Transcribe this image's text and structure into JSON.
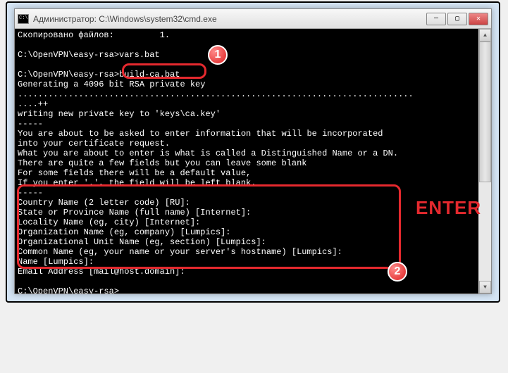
{
  "window": {
    "title": "Администратор: C:\\Windows\\system32\\cmd.exe"
  },
  "console": {
    "line1": "Скопировано файлов:         1.",
    "line2": "",
    "line3": "C:\\OpenVPN\\easy-rsa>vars.bat",
    "line4": "",
    "line5": "C:\\OpenVPN\\easy-rsa>build-ca.bat",
    "line6": "Generating a 4096 bit RSA private key",
    "line7": "..............................................................................",
    "line8": "....++",
    "line9": "writing new private key to 'keys\\ca.key'",
    "line10": "-----",
    "line11": "You are about to be asked to enter information that will be incorporated",
    "line12": "into your certificate request.",
    "line13": "What you are about to enter is what is called a Distinguished Name or a DN.",
    "line14": "There are quite a few fields but you can leave some blank",
    "line15": "For some fields there will be a default value,",
    "line16": "If you enter '.', the field will be left blank.",
    "line17": "-----",
    "line18": "Country Name (2 letter code) [RU]:",
    "line19": "State or Province Name (full name) [Internet]:",
    "line20": "Locality Name (eg, city) [Internet]:",
    "line21": "Organization Name (eg, company) [Lumpics]:",
    "line22": "Organizational Unit Name (eg, section) [Lumpics]:",
    "line23": "Common Name (eg, your name or your server's hostname) [Lumpics]:",
    "line24": "Name [Lumpics]:",
    "line25": "Email Address [mail@host.domain]:",
    "line26": "",
    "line27": "C:\\OpenVPN\\easy-rsa>"
  },
  "annotations": {
    "marker1": "1",
    "marker2": "2",
    "enter": "ENTER"
  }
}
